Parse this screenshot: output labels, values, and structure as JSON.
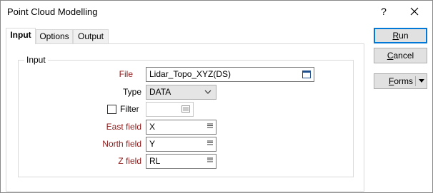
{
  "window": {
    "title": "Point Cloud Modelling",
    "help_label": "?"
  },
  "tabs": [
    {
      "label": "Input",
      "active": true
    },
    {
      "label": "Options",
      "active": false
    },
    {
      "label": "Output",
      "active": false
    }
  ],
  "input_group": {
    "legend": "Input",
    "file": {
      "label": "File",
      "value": "Lidar_Topo_XYZ(DS)",
      "icon": "browse-file-icon"
    },
    "type": {
      "label": "Type",
      "value": "DATA"
    },
    "filter": {
      "label": "Filter",
      "checked": false,
      "value": "",
      "icon": "filter-list-icon"
    },
    "east_field": {
      "label": "East field",
      "value": "X"
    },
    "north_field": {
      "label": "North field",
      "value": "Y"
    },
    "z_field": {
      "label": "Z field",
      "value": "RL"
    }
  },
  "buttons": {
    "run": {
      "label_accel": "R",
      "label_rest": "un"
    },
    "cancel": {
      "label_accel": "C",
      "label_rest": "ancel"
    },
    "forms": {
      "label_accel": "F",
      "label_rest": "orms"
    }
  },
  "colors": {
    "required_label": "#8b1a1a",
    "default_button_border": "#0078d7",
    "button_face": "#e1e1e1"
  }
}
